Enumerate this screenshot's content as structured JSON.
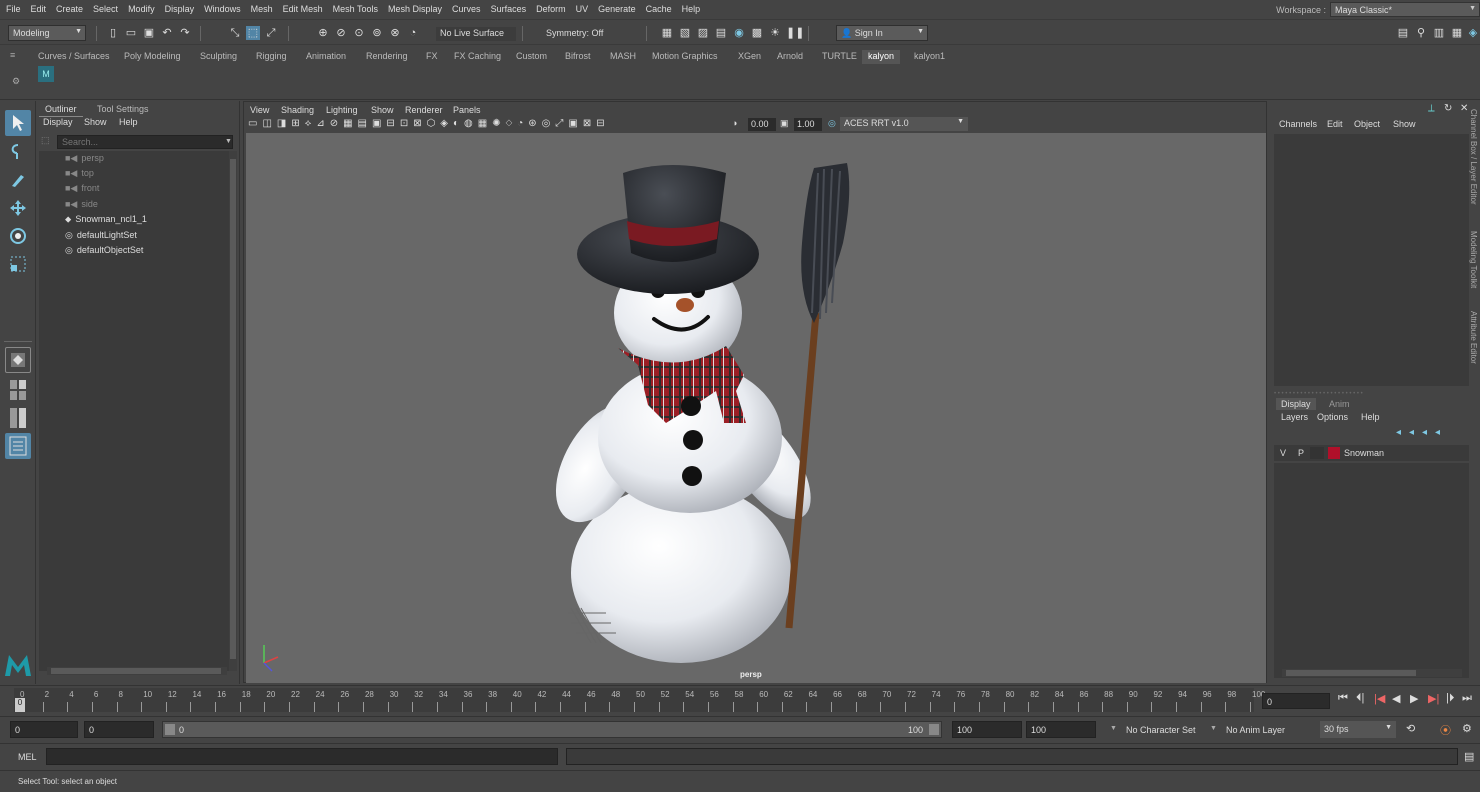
{
  "menubar": {
    "items": [
      "File",
      "Edit",
      "Create",
      "Select",
      "Modify",
      "Display",
      "Windows",
      "Mesh",
      "Edit Mesh",
      "Mesh Tools",
      "Mesh Display",
      "Curves",
      "Surfaces",
      "Deform",
      "UV",
      "Generate",
      "Cache",
      "Help"
    ],
    "workspace_label": "Workspace :",
    "workspace_value": "Maya Classic*"
  },
  "statusline": {
    "mode": "Modeling",
    "live_surface": "No Live Surface",
    "symmetry": "Symmetry: Off",
    "sign_in": "Sign In"
  },
  "shelf": {
    "tabs": [
      "Curves / Surfaces",
      "Poly Modeling",
      "Sculpting",
      "Rigging",
      "Animation",
      "Rendering",
      "FX",
      "FX Caching",
      "Custom",
      "Bifrost",
      "MASH",
      "Motion Graphics",
      "XGen",
      "Arnold",
      "TURTLE",
      "kalyon",
      "kalyon1"
    ],
    "active_tab": "kalyon"
  },
  "outliner": {
    "tabs": [
      "Outliner",
      "Tool Settings"
    ],
    "menu": [
      "Display",
      "Show",
      "Help"
    ],
    "search_placeholder": "Search...",
    "items": [
      {
        "label": "persp",
        "icon": "camera-icon",
        "dim": true
      },
      {
        "label": "top",
        "icon": "camera-icon",
        "dim": true
      },
      {
        "label": "front",
        "icon": "camera-icon",
        "dim": true
      },
      {
        "label": "side",
        "icon": "camera-icon",
        "dim": true
      },
      {
        "label": "Snowman_ncl1_1",
        "icon": "transform-icon",
        "dim": false
      },
      {
        "label": "defaultLightSet",
        "icon": "set-icon",
        "dim": false
      },
      {
        "label": "defaultObjectSet",
        "icon": "set-icon",
        "dim": false
      }
    ]
  },
  "viewport": {
    "menu": [
      "View",
      "Shading",
      "Lighting",
      "Show",
      "Renderer",
      "Panels"
    ],
    "exposure": "0.00",
    "gamma": "1.00",
    "color_space": "ACES RRT v1.0",
    "camera_label": "persp"
  },
  "channels": {
    "menu": [
      "Channels",
      "Edit",
      "Object",
      "Show"
    ],
    "side_tabs": [
      "Channel Box / Layer Editor",
      "Modeling Toolkit",
      "Attribute Editor"
    ],
    "layer_tabs": [
      "Display",
      "Anim"
    ],
    "layer_menu": [
      "Layers",
      "Options",
      "Help"
    ],
    "layer": {
      "v": "V",
      "p": "P",
      "name": "Snowman",
      "color": "#b0102a"
    }
  },
  "timeslider": {
    "ticks": [
      "0",
      "2",
      "4",
      "6",
      "8",
      "10",
      "12",
      "14",
      "16",
      "18",
      "20",
      "22",
      "24",
      "26",
      "28",
      "30",
      "32",
      "34",
      "36",
      "38",
      "40",
      "42",
      "44",
      "46",
      "48",
      "50",
      "52",
      "54",
      "56",
      "58",
      "60",
      "62",
      "64",
      "66",
      "68",
      "70",
      "72",
      "74",
      "76",
      "78",
      "80",
      "82",
      "84",
      "86",
      "88",
      "90",
      "92",
      "94",
      "96",
      "98",
      "100"
    ],
    "current_frame": "0",
    "current_marker": "0"
  },
  "range": {
    "start": "0",
    "start_inner": "0",
    "slider_start": "0",
    "slider_end": "100",
    "end_inner": "100",
    "end": "100",
    "character_set": "No Character Set",
    "anim_layer": "No Anim Layer",
    "fps": "30 fps"
  },
  "cmdline": {
    "label": "MEL"
  },
  "helpline": {
    "text": "Select Tool: select an object"
  },
  "colors": {
    "accent": "#5285a6",
    "viewport_bg": "#686868"
  }
}
